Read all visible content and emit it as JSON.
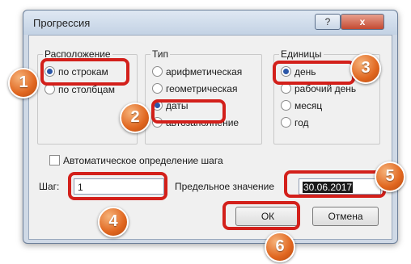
{
  "dialog": {
    "title": "Прогрессия",
    "help_label": "?",
    "close_label": "x"
  },
  "layout_group": {
    "legend": "Расположение",
    "options": [
      "по строкам",
      "по столбцам"
    ],
    "selected": "по строкам"
  },
  "type_group": {
    "legend": "Тип",
    "options": [
      "арифметическая",
      "геометрическая",
      "даты",
      "автозаполнение"
    ],
    "selected": "даты"
  },
  "units_group": {
    "legend": "Единицы",
    "options": [
      "день",
      "рабочий день",
      "месяц",
      "год"
    ],
    "selected": "день"
  },
  "auto_step": {
    "label": "Автоматическое определение шага",
    "checked": false
  },
  "step": {
    "label": "Шаг:",
    "value": "1"
  },
  "limit": {
    "label": "Предельное значение",
    "value": "30.06.2017"
  },
  "buttons": {
    "ok": "ОК",
    "cancel": "Отмена"
  },
  "annotations": {
    "badges": [
      "1",
      "2",
      "3",
      "4",
      "5",
      "6"
    ],
    "color": "#d3201b",
    "badge_color": "#e0661f"
  }
}
